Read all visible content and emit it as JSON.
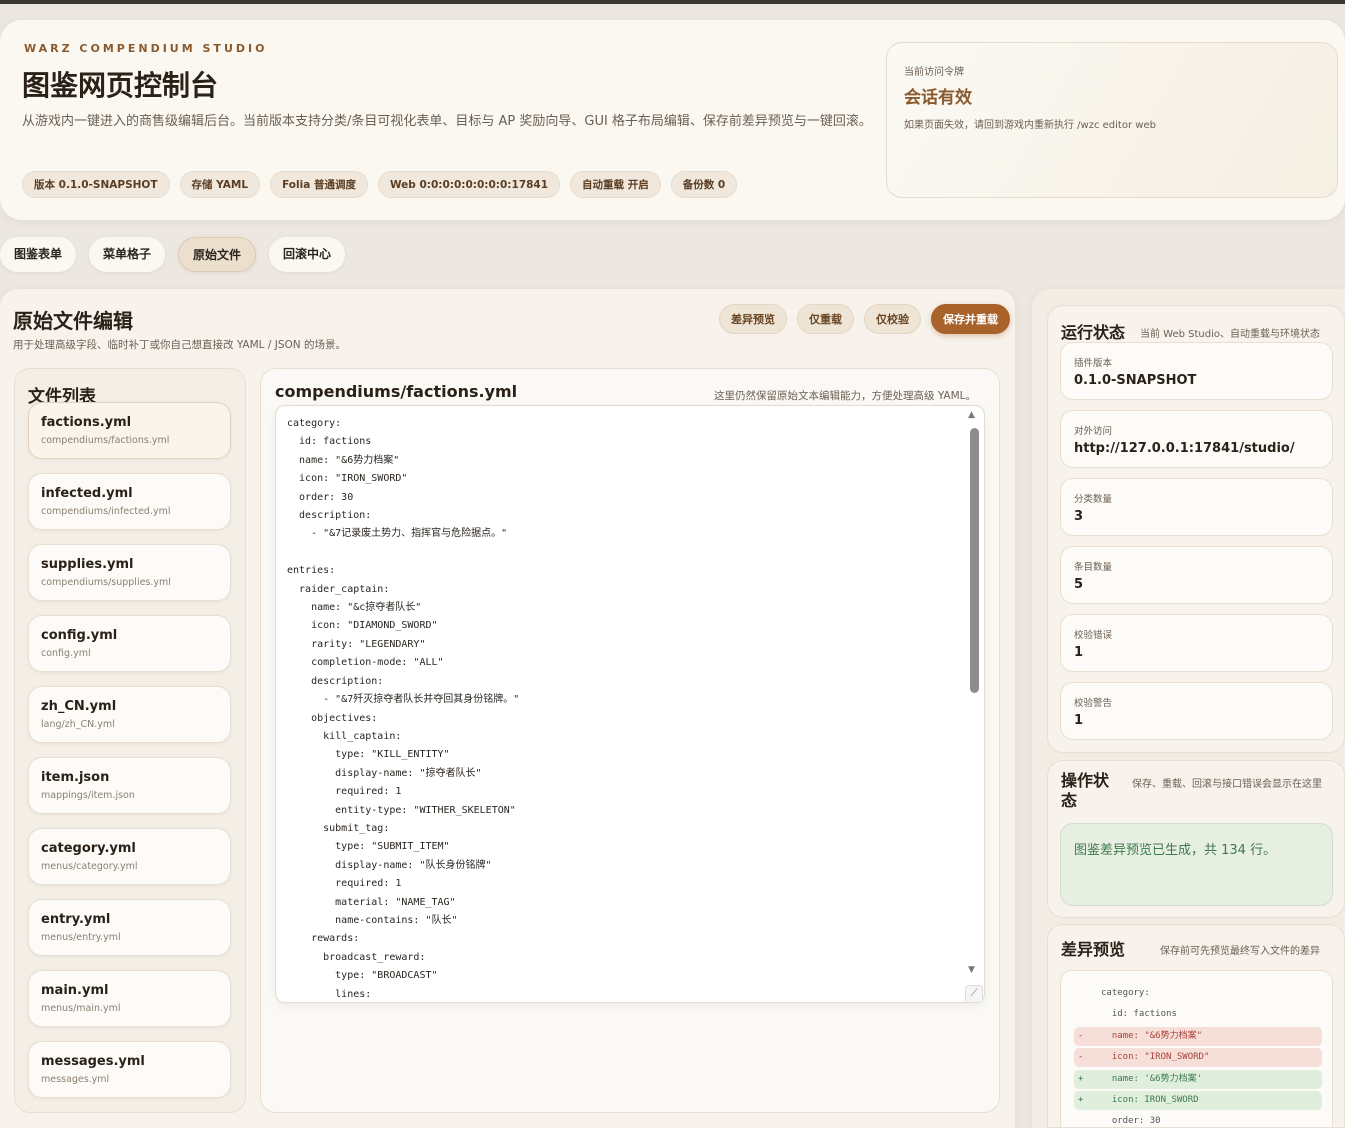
{
  "hero": {
    "eyebrow": "WARZ COMPENDIUM STUDIO",
    "title": "图鉴网页控制台",
    "description": "从游戏内一键进入的商售级编辑后台。当前版本支持分类/条目可视化表单、目标与 AP 奖励向导、GUI 格子布局编辑、保存前差异预览与一键回滚。",
    "chips": [
      "版本 0.1.0-SNAPSHOT",
      "存储 YAML",
      "Folia 普通调度",
      "Web 0:0:0:0:0:0:0:0:17841",
      "自动重载 开启",
      "备份数 0"
    ]
  },
  "session": {
    "label": "当前访问令牌",
    "value": "会话有效",
    "hint": "如果页面失效，请回到游戏内重新执行 /wzc editor web"
  },
  "tabs": [
    "图鉴表单",
    "菜单格子",
    "原始文件",
    "回滚中心"
  ],
  "editor": {
    "title": "原始文件编辑",
    "subtitle": "用于处理高级字段、临时补丁或你自己想直接改 YAML / JSON 的场景。",
    "buttons": {
      "diff": "差异预览",
      "reload": "仅重载",
      "validate": "仅校验",
      "save": "保存并重载"
    },
    "files_title": "文件列表",
    "files": [
      {
        "name": "factions.yml",
        "path": "compendiums/factions.yml"
      },
      {
        "name": "infected.yml",
        "path": "compendiums/infected.yml"
      },
      {
        "name": "supplies.yml",
        "path": "compendiums/supplies.yml"
      },
      {
        "name": "config.yml",
        "path": "config.yml"
      },
      {
        "name": "zh_CN.yml",
        "path": "lang/zh_CN.yml"
      },
      {
        "name": "item.json",
        "path": "mappings/item.json"
      },
      {
        "name": "category.yml",
        "path": "menus/category.yml"
      },
      {
        "name": "entry.yml",
        "path": "menus/entry.yml"
      },
      {
        "name": "main.yml",
        "path": "menus/main.yml"
      },
      {
        "name": "messages.yml",
        "path": "messages.yml"
      }
    ],
    "current_file": "compendiums/factions.yml",
    "hint": "这里仍然保留原始文本编辑能力，方便处理高级 YAML。",
    "code": "category:\n  id: factions\n  name: \"&6势力档案\"\n  icon: \"IRON_SWORD\"\n  order: 30\n  description:\n    - \"&7记录废土势力、指挥官与危险据点。\"\n\nentries:\n  raider_captain:\n    name: \"&c掠夺者队长\"\n    icon: \"DIAMOND_SWORD\"\n    rarity: \"LEGENDARY\"\n    completion-mode: \"ALL\"\n    description:\n      - \"&7歼灭掠夺者队长并夺回其身份铭牌。\"\n    objectives:\n      kill_captain:\n        type: \"KILL_ENTITY\"\n        display-name: \"掠夺者队长\"\n        required: 1\n        entity-type: \"WITHER_SKELETON\"\n      submit_tag:\n        type: \"SUBMIT_ITEM\"\n        display-name: \"队长身份铭牌\"\n        required: 1\n        material: \"NAME_TAG\"\n        name-contains: \"队长\"\n    rewards:\n      broadcast_reward:\n        type: \"BROADCAST\"\n        lines:"
  },
  "status": {
    "title": "运行状态",
    "subtitle": "当前 Web Studio、自动重载与环境状态",
    "items": [
      {
        "label": "插件版本",
        "value": "0.1.0-SNAPSHOT"
      },
      {
        "label": "对外访问",
        "value": "http://127.0.0.1:17841/studio/"
      },
      {
        "label": "分类数量",
        "value": "3"
      },
      {
        "label": "条目数量",
        "value": "5"
      },
      {
        "label": "校验错误",
        "value": "1"
      },
      {
        "label": "校验警告",
        "value": "1"
      }
    ]
  },
  "operation": {
    "title": "操作状态",
    "subtitle": "保存、重载、回滚与接口错误会显示在这里",
    "message": "图鉴差异预览已生成，共 134 行。"
  },
  "diff": {
    "title": "差异预览",
    "subtitle": "保存前可先预览最终写入文件的差异",
    "lines": [
      {
        "kind": "ctx",
        "marker": "",
        "text": "category:"
      },
      {
        "kind": "ctx",
        "marker": "",
        "text": "  id: factions"
      },
      {
        "kind": "del",
        "marker": "-",
        "text": "  name: \"&6势力档案\""
      },
      {
        "kind": "del",
        "marker": "-",
        "text": "  icon: \"IRON_SWORD\""
      },
      {
        "kind": "add",
        "marker": "+",
        "text": "  name: '&6势力档案'"
      },
      {
        "kind": "add",
        "marker": "+",
        "text": "  icon: IRON_SWORD"
      },
      {
        "kind": "ctx",
        "marker": "",
        "text": "  order: 30"
      }
    ]
  }
}
